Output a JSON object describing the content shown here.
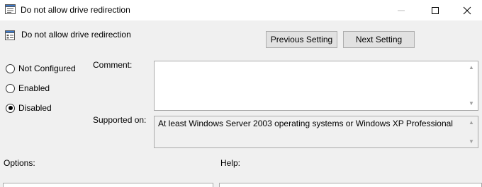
{
  "window": {
    "title": "Do not allow drive redirection",
    "min_icon": "minimize-icon",
    "max_icon": "maximize-icon",
    "close_icon": "close-icon"
  },
  "header": {
    "title": "Do not allow drive redirection",
    "icon": "policy-setting-icon"
  },
  "nav": {
    "previous_label": "Previous Setting",
    "next_label": "Next Setting"
  },
  "state": {
    "options": [
      {
        "label": "Not Configured",
        "checked": false
      },
      {
        "label": "Enabled",
        "checked": false
      },
      {
        "label": "Disabled",
        "checked": true
      }
    ]
  },
  "comment": {
    "label": "Comment:",
    "value": ""
  },
  "supported": {
    "label": "Supported on:",
    "value": "At least Windows Server 2003 operating systems or Windows XP Professional"
  },
  "sections": {
    "options_label": "Options:",
    "help_label": "Help:"
  },
  "colors": {
    "window_bg": "#f0f0f0",
    "titlebar_bg": "#ffffff",
    "button_bg": "#e1e1e1",
    "border": "#adadad"
  }
}
